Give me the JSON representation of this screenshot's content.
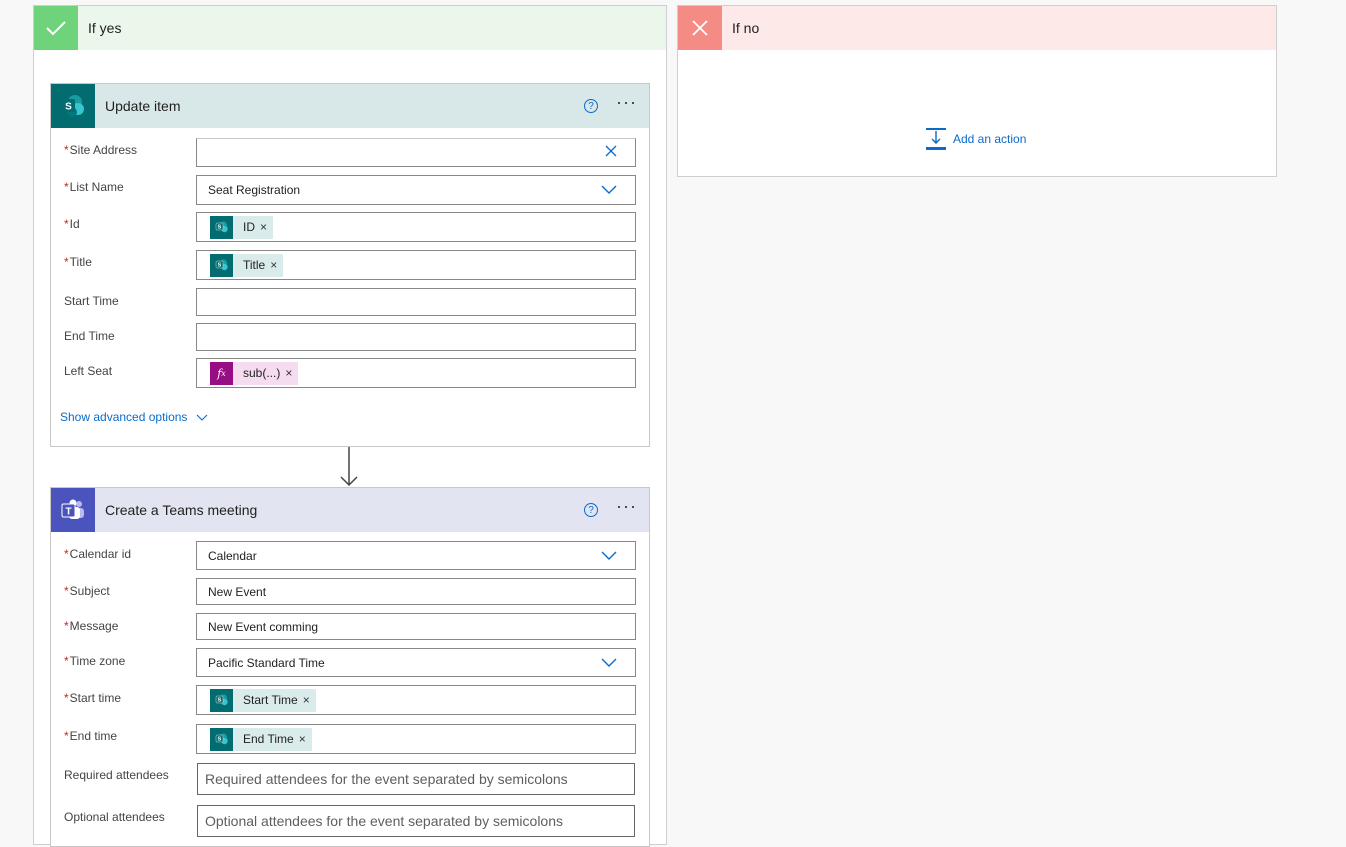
{
  "branches": {
    "yes": {
      "title": "If yes"
    },
    "no": {
      "title": "If no",
      "add_action": "Add an action"
    }
  },
  "update_item": {
    "title": "Update item",
    "help": "?",
    "more": "···",
    "fields": {
      "site_address": {
        "label": "Site Address",
        "value": ""
      },
      "list_name": {
        "label": "List Name",
        "value": "Seat Registration"
      },
      "id": {
        "label": "Id",
        "token": "ID"
      },
      "title": {
        "label": "Title",
        "token": "Title"
      },
      "start_time": {
        "label": "Start Time",
        "value": ""
      },
      "end_time": {
        "label": "End Time",
        "value": ""
      },
      "left_seat": {
        "label": "Left Seat",
        "token": "sub(...)"
      }
    },
    "show_advanced": "Show advanced options"
  },
  "teams_meeting": {
    "title": "Create a Teams meeting",
    "help": "?",
    "more": "···",
    "fields": {
      "calendar_id": {
        "label": "Calendar id",
        "value": "Calendar"
      },
      "subject": {
        "label": "Subject",
        "value": "New Event"
      },
      "message": {
        "label": "Message",
        "value": "New Event comming"
      },
      "time_zone": {
        "label": "Time zone",
        "value": "Pacific Standard Time"
      },
      "start_time": {
        "label": "Start time",
        "token": "Start Time"
      },
      "end_time": {
        "label": "End time",
        "token": "End Time"
      },
      "required_attendees": {
        "label": "Required attendees",
        "placeholder": "Required attendees for the event separated by semicolons"
      },
      "optional_attendees": {
        "label": "Optional attendees",
        "placeholder": "Optional attendees for the event separated by semicolons"
      }
    }
  },
  "common": {
    "required_mark": "*",
    "token_remove": "×"
  },
  "colors": {
    "yes_header": "#ebf7ea",
    "yes_icon": "#6ed37a",
    "no_header": "#fde9e7",
    "no_icon": "#f58b85",
    "sharepoint_header": "#d8e8e8",
    "sharepoint_brand": "#036c70",
    "teams_header": "#e2e4f1",
    "teams_brand": "#4b53bc",
    "link": "#0b6bcb",
    "fx_token": "#980d84"
  }
}
